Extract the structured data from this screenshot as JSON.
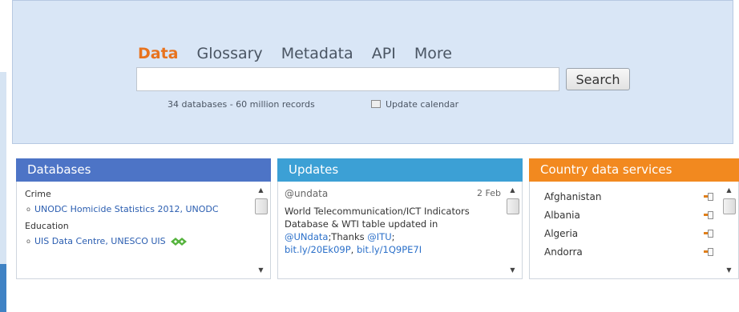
{
  "nav": {
    "tabs": [
      {
        "label": "Data",
        "active": true
      },
      {
        "label": "Glossary",
        "active": false
      },
      {
        "label": "Metadata",
        "active": false
      },
      {
        "label": "API",
        "active": false
      },
      {
        "label": "More",
        "active": false
      }
    ]
  },
  "search": {
    "value": "",
    "placeholder": "",
    "button_label": "Search",
    "stats": "34 databases - 60 million records",
    "calendar_label": "Update calendar"
  },
  "databases": {
    "title": "Databases",
    "categories": [
      {
        "name": "Crime",
        "items": [
          "UNODC Homicide Statistics 2012, UNODC"
        ]
      },
      {
        "name": "Education",
        "items": [
          "UIS Data Centre, UNESCO UIS"
        ]
      }
    ]
  },
  "updates": {
    "title": "Updates",
    "tweet": {
      "handle": "@undata",
      "date": "2 Feb",
      "text": "World Telecommunication/ICT Indicators Database & WTI table updated in ",
      "mention1": "@UNdata",
      "text2": ";Thanks ",
      "mention2": "@ITU",
      "text3": ";",
      "link1": "bit.ly/20Ek09P",
      "sep": ", ",
      "link2": "bit.ly/1Q9PE7I"
    }
  },
  "country_services": {
    "title": "Country data services",
    "countries": [
      "Afghanistan",
      "Albania",
      "Algeria",
      "Andorra"
    ]
  },
  "colors": {
    "databases_header": "#4d74c6",
    "updates_header": "#3ca0d5",
    "country_header": "#f2891f",
    "active_tab": "#e8731e",
    "search_panel": "#d9e6f6"
  }
}
